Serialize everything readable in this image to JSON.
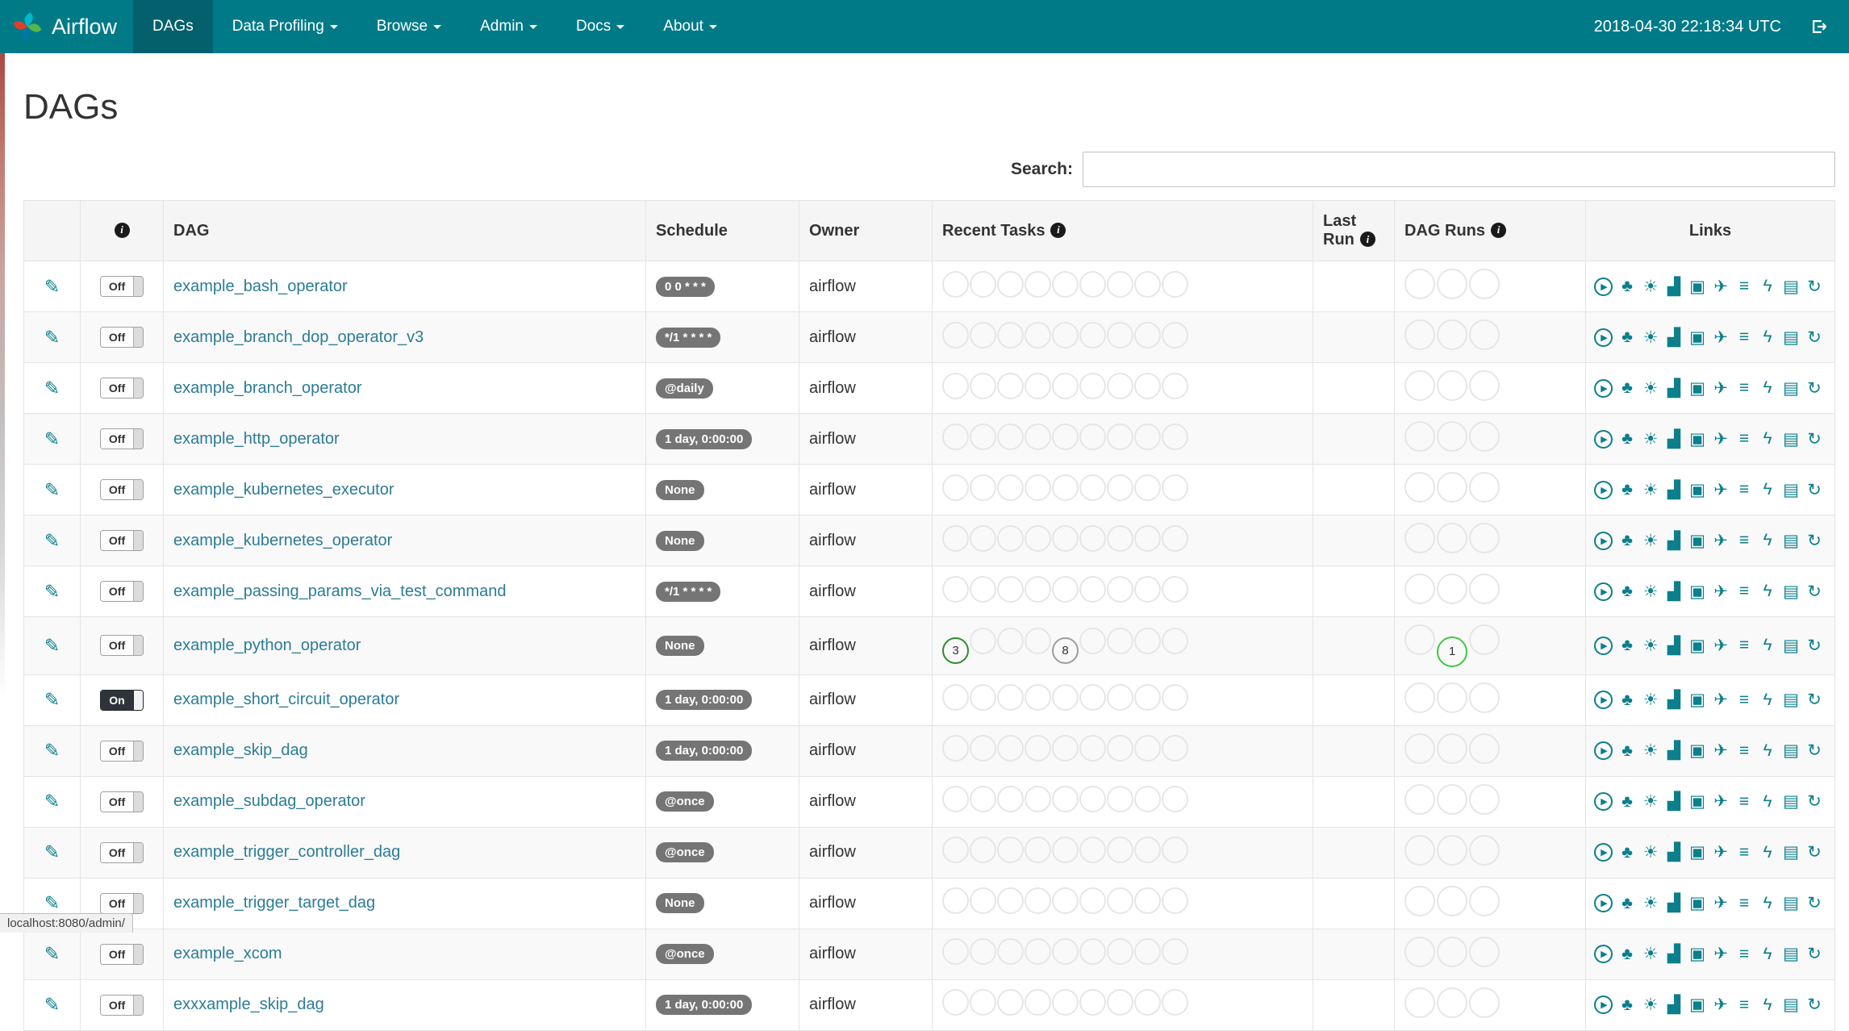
{
  "navbar": {
    "brand": "Airflow",
    "items": [
      {
        "label": "DAGs",
        "active": true,
        "dropdown": false
      },
      {
        "label": "Data Profiling",
        "active": false,
        "dropdown": true
      },
      {
        "label": "Browse",
        "active": false,
        "dropdown": true
      },
      {
        "label": "Admin",
        "active": false,
        "dropdown": true
      },
      {
        "label": "Docs",
        "active": false,
        "dropdown": true
      },
      {
        "label": "About",
        "active": false,
        "dropdown": true
      }
    ],
    "clock": "2018-04-30 22:18:34 UTC"
  },
  "page": {
    "title": "DAGs"
  },
  "search": {
    "label": "Search:",
    "value": ""
  },
  "table": {
    "icons": {
      "info_glyph": "i",
      "edit_glyph": "✎"
    },
    "headers": {
      "dag": "DAG",
      "schedule": "Schedule",
      "owner": "Owner",
      "recent_tasks": "Recent Tasks",
      "last_run": "Last Run",
      "dag_runs": "DAG Runs",
      "links": "Links"
    },
    "recent_task_slots": 9,
    "dag_run_slots": 3,
    "link_icons": [
      {
        "name": "trigger-dag-icon",
        "glyph": "▶",
        "circled": true
      },
      {
        "name": "tree-view-icon",
        "glyph": "♣"
      },
      {
        "name": "graph-view-icon",
        "glyph": "☀"
      },
      {
        "name": "task-duration-icon",
        "glyph": "▟"
      },
      {
        "name": "task-tries-icon",
        "glyph": "▣"
      },
      {
        "name": "landing-times-icon",
        "glyph": "✈"
      },
      {
        "name": "gantt-icon",
        "glyph": "≡"
      },
      {
        "name": "code-icon",
        "glyph": "ϟ"
      },
      {
        "name": "logs-icon",
        "glyph": "▤"
      },
      {
        "name": "refresh-icon",
        "glyph": "↻"
      }
    ],
    "rows": [
      {
        "dag_id": "example_bash_operator",
        "toggle": "Off",
        "enabled": false,
        "schedule": "0 0 * * *",
        "owner": "airflow",
        "recent_tasks": [],
        "dag_runs": []
      },
      {
        "dag_id": "example_branch_dop_operator_v3",
        "toggle": "Off",
        "enabled": false,
        "schedule": "*/1 * * * *",
        "owner": "airflow",
        "recent_tasks": [],
        "dag_runs": []
      },
      {
        "dag_id": "example_branch_operator",
        "toggle": "Off",
        "enabled": false,
        "schedule": "@daily",
        "owner": "airflow",
        "recent_tasks": [],
        "dag_runs": []
      },
      {
        "dag_id": "example_http_operator",
        "toggle": "Off",
        "enabled": false,
        "schedule": "1 day, 0:00:00",
        "owner": "airflow",
        "recent_tasks": [],
        "dag_runs": []
      },
      {
        "dag_id": "example_kubernetes_executor",
        "toggle": "Off",
        "enabled": false,
        "schedule": "None",
        "owner": "airflow",
        "recent_tasks": [],
        "dag_runs": []
      },
      {
        "dag_id": "example_kubernetes_operator",
        "toggle": "Off",
        "enabled": false,
        "schedule": "None",
        "owner": "airflow",
        "recent_tasks": [],
        "dag_runs": []
      },
      {
        "dag_id": "example_passing_params_via_test_command",
        "toggle": "Off",
        "enabled": false,
        "schedule": "*/1 * * * *",
        "owner": "airflow",
        "recent_tasks": [],
        "dag_runs": []
      },
      {
        "dag_id": "example_python_operator",
        "toggle": "Off",
        "enabled": false,
        "schedule": "None",
        "owner": "airflow",
        "recent_tasks": [
          {
            "index": 0,
            "count": "3",
            "state": "success",
            "color": "#2f8b2f"
          },
          {
            "index": 4,
            "count": "8",
            "state": "skipped",
            "color": "#9d9d9d"
          }
        ],
        "dag_runs": [
          {
            "index": 1,
            "count": "1",
            "state": "running",
            "color": "#3fc93f"
          }
        ]
      },
      {
        "dag_id": "example_short_circuit_operator",
        "toggle": "On",
        "enabled": true,
        "schedule": "1 day, 0:00:00",
        "owner": "airflow",
        "recent_tasks": [],
        "dag_runs": []
      },
      {
        "dag_id": "example_skip_dag",
        "toggle": "Off",
        "enabled": false,
        "schedule": "1 day, 0:00:00",
        "owner": "airflow",
        "recent_tasks": [],
        "dag_runs": []
      },
      {
        "dag_id": "example_subdag_operator",
        "toggle": "Off",
        "enabled": false,
        "schedule": "@once",
        "owner": "airflow",
        "recent_tasks": [],
        "dag_runs": []
      },
      {
        "dag_id": "example_trigger_controller_dag",
        "toggle": "Off",
        "enabled": false,
        "schedule": "@once",
        "owner": "airflow",
        "recent_tasks": [],
        "dag_runs": []
      },
      {
        "dag_id": "example_trigger_target_dag",
        "toggle": "Off",
        "enabled": false,
        "schedule": "None",
        "owner": "airflow",
        "recent_tasks": [],
        "dag_runs": []
      },
      {
        "dag_id": "example_xcom",
        "toggle": "Off",
        "enabled": false,
        "schedule": "@once",
        "owner": "airflow",
        "recent_tasks": [],
        "dag_runs": []
      },
      {
        "dag_id": "exxxample_skip_dag",
        "toggle": "Off",
        "enabled": false,
        "schedule": "1 day, 0:00:00",
        "owner": "airflow",
        "recent_tasks": [],
        "dag_runs": []
      }
    ]
  },
  "status_bar": {
    "text": "localhost:8080/admin/"
  }
}
